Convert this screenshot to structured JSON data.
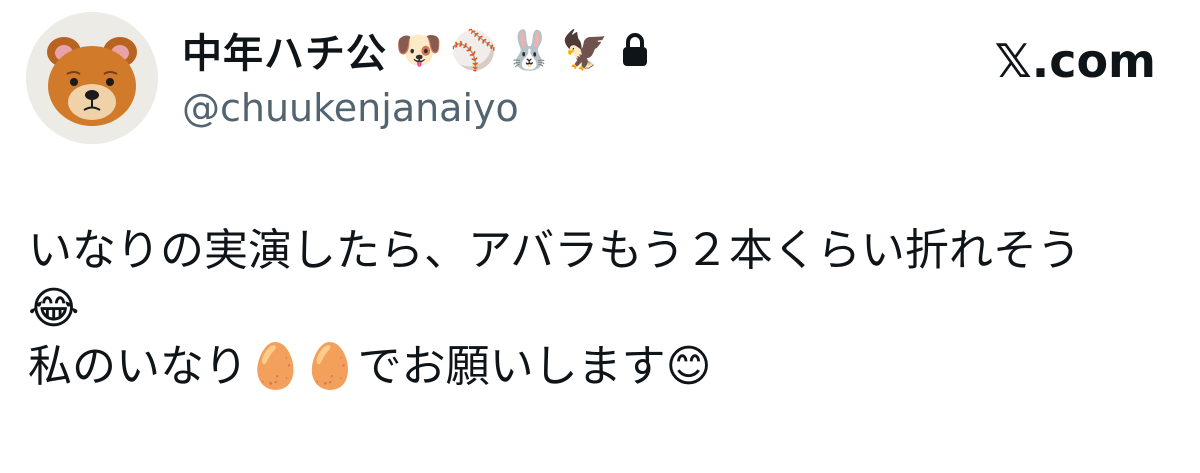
{
  "header": {
    "display_name": "中年ハチ公",
    "name_emojis": [
      "🐶",
      "⚾",
      "🐰",
      "🦅"
    ],
    "handle": "@chuukenjanaiyo",
    "brand": "𝕏.com",
    "lock_icon": "lock-icon"
  },
  "tweet": {
    "line1": "いなりの実演したら、アバラもう２本くらい折れそう",
    "line2_emoji": "😂",
    "line3_text_a": "私のいなり",
    "line3_emojis": [
      "🥚",
      "🥚"
    ],
    "line3_text_b": "でお願いします",
    "line3_emoji_end": "😊"
  },
  "colors": {
    "text": "#0f1419",
    "secondary": "#536471",
    "background": "#ffffff"
  }
}
